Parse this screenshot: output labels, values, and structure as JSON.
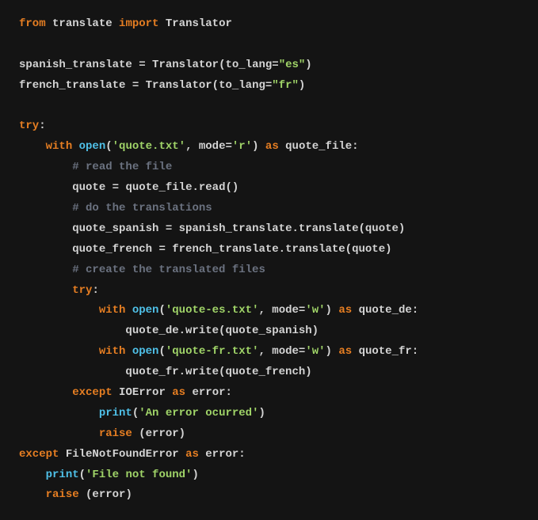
{
  "code": {
    "l1": {
      "kw_from": "from",
      "mod1": "translate",
      "kw_import": "import",
      "mod2": "Translator"
    },
    "l3": {
      "var": "spanish_translate ",
      "eq": "= ",
      "cls": "Translator",
      "lp": "(",
      "arg": "to_lang",
      "assgn": "=",
      "str": "\"es\"",
      "rp": ")"
    },
    "l4": {
      "var": "french_translate ",
      "eq": "= ",
      "cls": "Translator",
      "lp": "(",
      "arg": "to_lang",
      "assgn": "=",
      "str": "\"fr\"",
      "rp": ")"
    },
    "l6": {
      "kw": "try",
      "colon": ":"
    },
    "l7": {
      "kw_with": "with",
      "sp": " ",
      "open": "open",
      "lp": "(",
      "str1": "'quote.txt'",
      "comma": ", ",
      "mode": "mode",
      "assgn": "=",
      "str2": "'r'",
      "rp": ")",
      "sp2": " ",
      "kw_as": "as",
      "sp3": " ",
      "var": "quote_file",
      "colon": ":"
    },
    "l8": {
      "cmt": "# read the file"
    },
    "l9": {
      "var": "quote ",
      "eq": "= ",
      "obj": "quote_file.read()"
    },
    "l10": {
      "cmt": "# do the translations"
    },
    "l11": {
      "var": "quote_spanish ",
      "eq": "= ",
      "obj": "spanish_translate.translate(quote)"
    },
    "l12": {
      "var": "quote_french ",
      "eq": "= ",
      "obj": "french_translate.translate(quote)"
    },
    "l13": {
      "cmt": "# create the translated files"
    },
    "l14": {
      "kw": "try",
      "colon": ":"
    },
    "l15": {
      "kw_with": "with",
      "sp": " ",
      "open": "open",
      "lp": "(",
      "str1": "'quote-es.txt'",
      "comma": ", ",
      "mode": "mode",
      "assgn": "=",
      "str2": "'w'",
      "rp": ")",
      "sp2": " ",
      "kw_as": "as",
      "sp3": " ",
      "var": "quote_de",
      "colon": ":"
    },
    "l16": {
      "stmt": "quote_de.write(quote_spanish)"
    },
    "l17": {
      "kw_with": "with",
      "sp": " ",
      "open": "open",
      "lp": "(",
      "str1": "'quote-fr.txt'",
      "comma": ", ",
      "mode": "mode",
      "assgn": "=",
      "str2": "'w'",
      "rp": ")",
      "sp2": " ",
      "kw_as": "as",
      "sp3": " ",
      "var": "quote_fr",
      "colon": ":"
    },
    "l18": {
      "stmt": "quote_fr.write(quote_french)"
    },
    "l19": {
      "kw": "except",
      "sp": " ",
      "exc": "IOError",
      "sp2": " ",
      "kw_as": "as",
      "sp3": " ",
      "var": "error",
      "colon": ":"
    },
    "l20": {
      "fn": "print",
      "lp": "(",
      "str": "'An error ocurred'",
      "rp": ")"
    },
    "l21": {
      "kw": "raise",
      "sp": " ",
      "stmt": "(error)"
    },
    "l22": {
      "kw": "except",
      "sp": " ",
      "exc": "FileNotFoundError",
      "sp2": " ",
      "kw_as": "as",
      "sp3": " ",
      "var": "error",
      "colon": ":"
    },
    "l23": {
      "fn": "print",
      "lp": "(",
      "str": "'File not found'",
      "rp": ")"
    },
    "l24": {
      "kw": "raise",
      "sp": " ",
      "stmt": "(error)"
    }
  }
}
